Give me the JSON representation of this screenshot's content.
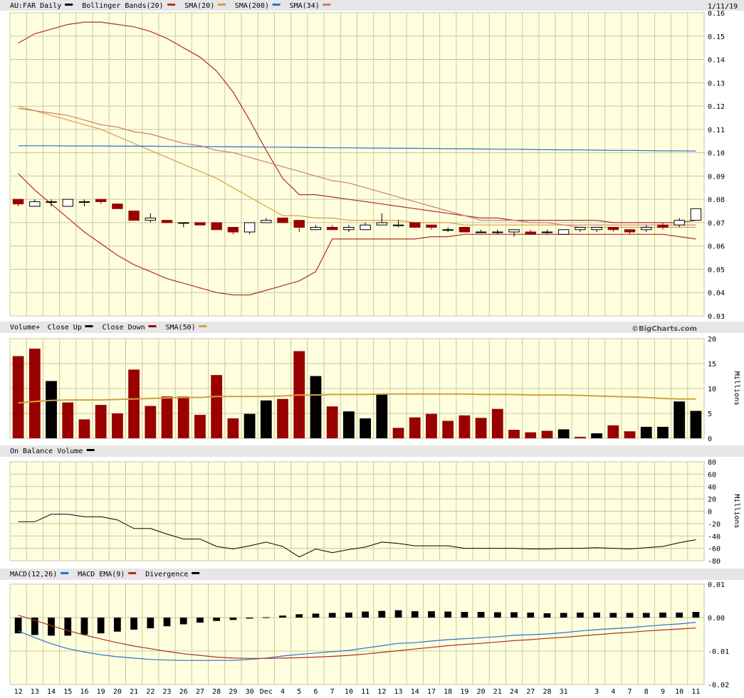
{
  "header": {
    "symbol": "AU:FAR Daily",
    "date": "1/11/19",
    "credit": "©BigCharts.com"
  },
  "colors": {
    "panel_bg": "#ffffe0",
    "grid": "#c8c89a",
    "header_bg": "#e6e6e6",
    "up": "#000000",
    "down": "#990000",
    "bollinger": "#b03020",
    "sma20": "#d2a040",
    "sma200": "#2a70d0",
    "sma34": "#d07878",
    "vol_sma": "#d2a040",
    "obv": "#000000",
    "macd": "#2a70d0",
    "macd_ema": "#b03020",
    "divergence": "#000000"
  },
  "chart_data": [
    {
      "type": "candlestick",
      "name": "price",
      "legend": [
        {
          "label": "AU:FAR Daily",
          "color": "#000000"
        },
        {
          "label": "Bollinger Bands(20)",
          "color": "#b03020"
        },
        {
          "label": "SMA(20)",
          "color": "#d2a040"
        },
        {
          "label": "SMA(200)",
          "color": "#2a70d0"
        },
        {
          "label": "SMA(34)",
          "color": "#d07878"
        }
      ],
      "ylim": [
        0.03,
        0.16
      ],
      "yticks": [
        "0.03",
        "0.04",
        "0.05",
        "0.06",
        "0.07",
        "0.08",
        "0.09",
        "0.10",
        "0.11",
        "0.12",
        "0.13",
        "0.14",
        "0.15",
        "0.16"
      ],
      "categories": [
        "12",
        "13",
        "14",
        "15",
        "16",
        "19",
        "20",
        "21",
        "22",
        "23",
        "26",
        "27",
        "28",
        "29",
        "30",
        "Dec",
        "4",
        "5",
        "6",
        "7",
        "10",
        "11",
        "12",
        "13",
        "14",
        "17",
        "18",
        "19",
        "20",
        "21",
        "24",
        "27",
        "28",
        "31",
        "Jan",
        "3",
        "4",
        "7",
        "8",
        "9",
        "10",
        "11"
      ],
      "x_labels": [
        "12",
        "13",
        "14",
        "15",
        "16",
        "19",
        "20",
        "21",
        "22",
        "23",
        "26",
        "27",
        "28",
        "29",
        "30",
        "Dec",
        "4",
        "5",
        "6",
        "7",
        "10",
        "11",
        "12",
        "13",
        "14",
        "17",
        "18",
        "19",
        "20",
        "21",
        "24",
        "27",
        "28",
        "31",
        "3",
        "4",
        "7",
        "8",
        "9",
        "10",
        "11"
      ],
      "open": [
        0.08,
        0.077,
        0.079,
        0.077,
        0.079,
        0.08,
        0.078,
        0.075,
        0.071,
        0.071,
        0.07,
        0.07,
        0.07,
        0.068,
        0.066,
        0.07,
        0.072,
        0.071,
        0.067,
        0.068,
        0.067,
        0.067,
        0.069,
        0.069,
        0.07,
        0.069,
        0.067,
        0.068,
        0.066,
        0.066,
        0.066,
        0.066,
        0.066,
        0.065,
        0.067,
        0.067,
        0.068,
        0.067,
        0.067,
        0.069,
        0.069,
        0.071
      ],
      "high": [
        0.08,
        0.08,
        0.08,
        0.08,
        0.08,
        0.08,
        0.078,
        0.075,
        0.074,
        0.071,
        0.07,
        0.07,
        0.07,
        0.068,
        0.068,
        0.072,
        0.072,
        0.071,
        0.069,
        0.069,
        0.069,
        0.07,
        0.074,
        0.071,
        0.07,
        0.069,
        0.068,
        0.068,
        0.067,
        0.067,
        0.067,
        0.067,
        0.067,
        0.067,
        0.068,
        0.068,
        0.068,
        0.067,
        0.069,
        0.07,
        0.072,
        0.076
      ],
      "low": [
        0.077,
        0.077,
        0.077,
        0.077,
        0.077,
        0.078,
        0.076,
        0.071,
        0.07,
        0.07,
        0.068,
        0.069,
        0.068,
        0.065,
        0.065,
        0.07,
        0.07,
        0.066,
        0.067,
        0.067,
        0.066,
        0.067,
        0.069,
        0.068,
        0.068,
        0.067,
        0.066,
        0.066,
        0.066,
        0.065,
        0.064,
        0.065,
        0.065,
        0.065,
        0.066,
        0.066,
        0.066,
        0.065,
        0.066,
        0.067,
        0.068,
        0.071
      ],
      "close": [
        0.078,
        0.079,
        0.079,
        0.08,
        0.079,
        0.079,
        0.076,
        0.071,
        0.072,
        0.07,
        0.07,
        0.069,
        0.067,
        0.066,
        0.07,
        0.071,
        0.07,
        0.068,
        0.068,
        0.067,
        0.068,
        0.069,
        0.07,
        0.069,
        0.068,
        0.068,
        0.067,
        0.066,
        0.066,
        0.066,
        0.067,
        0.065,
        0.066,
        0.067,
        0.068,
        0.068,
        0.067,
        0.066,
        0.068,
        0.068,
        0.071,
        0.076
      ],
      "series": [
        {
          "name": "Bollinger Upper",
          "values": [
            0.147,
            0.151,
            0.153,
            0.155,
            0.156,
            0.156,
            0.155,
            0.154,
            0.152,
            0.149,
            0.145,
            0.141,
            0.135,
            0.126,
            0.114,
            0.101,
            0.089,
            0.082,
            0.082,
            0.081,
            0.08,
            0.079,
            0.078,
            0.077,
            0.076,
            0.075,
            0.074,
            0.073,
            0.072,
            0.072,
            0.071,
            0.071,
            0.071,
            0.071,
            0.071,
            0.071,
            0.07,
            0.07,
            0.07,
            0.07,
            0.07,
            0.071
          ]
        },
        {
          "name": "Bollinger Lower",
          "values": [
            0.091,
            0.084,
            0.078,
            0.072,
            0.066,
            0.061,
            0.056,
            0.052,
            0.049,
            0.046,
            0.044,
            0.042,
            0.04,
            0.039,
            0.039,
            0.041,
            0.043,
            0.045,
            0.049,
            0.063,
            0.063,
            0.063,
            0.063,
            0.063,
            0.063,
            0.064,
            0.064,
            0.065,
            0.065,
            0.065,
            0.065,
            0.065,
            0.065,
            0.065,
            0.065,
            0.065,
            0.065,
            0.065,
            0.065,
            0.065,
            0.064,
            0.063
          ]
        },
        {
          "name": "SMA(20)",
          "values": [
            0.12,
            0.118,
            0.116,
            0.114,
            0.112,
            0.11,
            0.107,
            0.104,
            0.101,
            0.098,
            0.095,
            0.092,
            0.089,
            0.085,
            0.081,
            0.077,
            0.073,
            0.073,
            0.072,
            0.072,
            0.071,
            0.071,
            0.071,
            0.071,
            0.07,
            0.07,
            0.07,
            0.069,
            0.069,
            0.069,
            0.069,
            0.069,
            0.069,
            0.069,
            0.068,
            0.068,
            0.068,
            0.068,
            0.068,
            0.068,
            0.068,
            0.068
          ]
        },
        {
          "name": "SMA(200)",
          "values": [
            0.103,
            0.103,
            0.103,
            0.1029,
            0.1029,
            0.1029,
            0.1028,
            0.1028,
            0.1028,
            0.1027,
            0.1027,
            0.1026,
            0.1026,
            0.1025,
            0.1025,
            0.1024,
            0.1024,
            0.1023,
            0.1022,
            0.1021,
            0.1021,
            0.102,
            0.102,
            0.1019,
            0.1019,
            0.1018,
            0.1017,
            0.1017,
            0.1016,
            0.1015,
            0.1015,
            0.1014,
            0.1013,
            0.1012,
            0.1012,
            0.1011,
            0.101,
            0.101,
            0.1009,
            0.1008,
            0.1008,
            0.1007
          ]
        },
        {
          "name": "SMA(34)",
          "values": [
            0.119,
            0.118,
            0.117,
            0.116,
            0.114,
            0.112,
            0.111,
            0.109,
            0.108,
            0.106,
            0.104,
            0.103,
            0.101,
            0.1,
            0.098,
            0.096,
            0.094,
            0.092,
            0.09,
            0.088,
            0.087,
            0.085,
            0.083,
            0.081,
            0.079,
            0.077,
            0.075,
            0.073,
            0.071,
            0.071,
            0.071,
            0.07,
            0.07,
            0.069,
            0.069,
            0.069,
            0.069,
            0.069,
            0.069,
            0.069,
            0.069,
            0.069
          ]
        }
      ]
    },
    {
      "type": "bar",
      "name": "volume",
      "legend": [
        {
          "label": "Volume+",
          "color": null
        },
        {
          "label": "Close Up",
          "color": "#000000"
        },
        {
          "label": "Close Down",
          "color": "#990000"
        },
        {
          "label": "SMA(50)",
          "color": "#d2a040"
        }
      ],
      "ylabel": "Millions",
      "ylim": [
        0,
        20
      ],
      "yticks": [
        "0",
        "5",
        "10",
        "15",
        "20"
      ],
      "values": [
        16.5,
        18.0,
        11.5,
        7.2,
        3.8,
        6.7,
        5.0,
        13.8,
        6.5,
        8.4,
        8.4,
        4.7,
        12.7,
        4.0,
        4.9,
        7.6,
        7.9,
        17.5,
        12.5,
        6.4,
        5.4,
        4.0,
        8.8,
        2.1,
        4.2,
        4.9,
        3.5,
        4.6,
        4.1,
        5.9,
        1.7,
        1.2,
        1.5,
        1.8,
        0.3,
        1.0,
        2.6,
        1.4,
        2.3,
        2.3,
        7.4,
        5.5
      ],
      "up": [
        false,
        false,
        true,
        false,
        false,
        false,
        false,
        false,
        false,
        false,
        false,
        false,
        false,
        false,
        true,
        true,
        false,
        false,
        true,
        false,
        true,
        true,
        true,
        false,
        false,
        false,
        false,
        false,
        false,
        false,
        false,
        false,
        false,
        true,
        false,
        true,
        false,
        false,
        true,
        true,
        true,
        true
      ],
      "sma_values": [
        7.1,
        7.4,
        7.6,
        7.7,
        7.7,
        7.7,
        7.8,
        7.9,
        8.0,
        8.1,
        8.2,
        8.2,
        8.4,
        8.4,
        8.4,
        8.4,
        8.5,
        8.7,
        8.7,
        8.8,
        8.8,
        8.8,
        8.9,
        8.9,
        8.9,
        8.9,
        8.9,
        8.9,
        8.8,
        8.8,
        8.8,
        8.7,
        8.7,
        8.7,
        8.6,
        8.5,
        8.4,
        8.3,
        8.2,
        8.0,
        7.9,
        7.9
      ]
    },
    {
      "type": "line",
      "name": "obv",
      "legend": [
        {
          "label": "On Balance Volume",
          "color": "#000000"
        }
      ],
      "ylabel": "Millions",
      "ylim": [
        -80,
        80
      ],
      "yticks": [
        "80",
        "60",
        "40",
        "20",
        "0",
        "-20",
        "-40",
        "-60",
        "-80"
      ],
      "values": [
        -17,
        -17,
        -5,
        -5,
        -9,
        -9,
        -14,
        -28,
        -28,
        -37,
        -45,
        -45,
        -57,
        -61,
        -56,
        -50,
        -57,
        -74,
        -61,
        -67,
        -62,
        -58,
        -50,
        -52,
        -56,
        -56,
        -56,
        -60,
        -60,
        -60,
        -60,
        -61,
        -61,
        -60,
        -60,
        -59,
        -60,
        -61,
        -59,
        -57,
        -51,
        -46
      ]
    },
    {
      "type": "line",
      "name": "macd",
      "legend": [
        {
          "label": "MACD(12,26)",
          "color": "#2a70d0"
        },
        {
          "label": "MACD EMA(9)",
          "color": "#b03020"
        },
        {
          "label": "Divergence",
          "color": "#000000"
        }
      ],
      "ylim": [
        -0.02,
        0.01
      ],
      "yticks": [
        "0.01",
        "0.00",
        "-0.01",
        "-0.02"
      ],
      "series": [
        {
          "name": "MACD(12,26)",
          "values": [
            -0.004,
            -0.006,
            -0.0078,
            -0.0093,
            -0.0103,
            -0.0111,
            -0.0117,
            -0.0121,
            -0.0125,
            -0.0127,
            -0.0128,
            -0.0128,
            -0.0128,
            -0.0128,
            -0.0125,
            -0.0121,
            -0.0115,
            -0.011,
            -0.0106,
            -0.0102,
            -0.0098,
            -0.0091,
            -0.0084,
            -0.0077,
            -0.0075,
            -0.007,
            -0.0066,
            -0.0063,
            -0.006,
            -0.0057,
            -0.0053,
            -0.0051,
            -0.0049,
            -0.0045,
            -0.004,
            -0.0036,
            -0.0033,
            -0.003,
            -0.0026,
            -0.0022,
            -0.0019,
            -0.0014
          ]
        },
        {
          "name": "MACD EMA(9)",
          "values": [
            0.0007,
            -0.0008,
            -0.0024,
            -0.0039,
            -0.0052,
            -0.0064,
            -0.0075,
            -0.0085,
            -0.0093,
            -0.0101,
            -0.0108,
            -0.0113,
            -0.0118,
            -0.0121,
            -0.0122,
            -0.0122,
            -0.0121,
            -0.012,
            -0.0118,
            -0.0116,
            -0.0113,
            -0.0109,
            -0.0104,
            -0.0099,
            -0.0094,
            -0.0089,
            -0.0084,
            -0.008,
            -0.0077,
            -0.0073,
            -0.0069,
            -0.0066,
            -0.0062,
            -0.0059,
            -0.0055,
            -0.0051,
            -0.0047,
            -0.0044,
            -0.004,
            -0.0037,
            -0.0034,
            -0.0031
          ]
        },
        {
          "name": "Divergence",
          "values": [
            -0.0047,
            -0.0052,
            -0.0054,
            -0.0054,
            -0.0051,
            -0.0047,
            -0.0042,
            -0.0036,
            -0.0032,
            -0.0026,
            -0.002,
            -0.0015,
            -0.001,
            -0.0007,
            -0.0003,
            0.0001,
            0.0006,
            0.001,
            0.0012,
            0.0014,
            0.0015,
            0.0018,
            0.002,
            0.0022,
            0.0019,
            0.0019,
            0.0018,
            0.0017,
            0.0017,
            0.0016,
            0.0016,
            0.0015,
            0.0013,
            0.0014,
            0.0015,
            0.0015,
            0.0014,
            0.0014,
            0.0014,
            0.0015,
            0.0015,
            0.0017
          ]
        }
      ]
    }
  ]
}
